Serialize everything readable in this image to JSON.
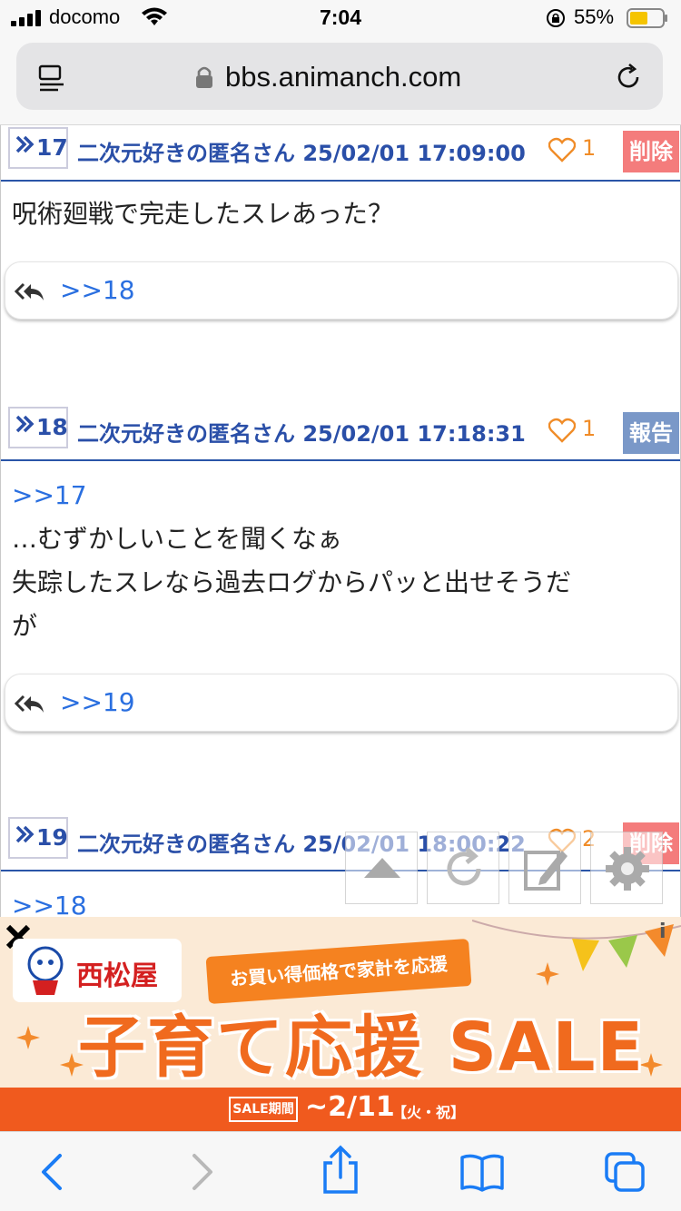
{
  "status_bar": {
    "carrier": "docomo",
    "time": "7:04",
    "battery": "55%"
  },
  "browser": {
    "url": "bbs.animanch.com"
  },
  "posts": [
    {
      "num": "17",
      "meta": "二次元好きの匿名さん 25/02/01 17:09:00",
      "likes": "1",
      "action": "削除",
      "body_lines": [
        "呪術廻戦で完走したスレあった？"
      ],
      "reply": ">>18"
    },
    {
      "num": "18",
      "meta": "二次元好きの匿名さん 25/02/01 17:18:31",
      "likes": "1",
      "action": "報告",
      "anchor": ">>17",
      "body_lines": [
        "…むずかしいことを聞くなぁ",
        "失踪したスレなら過去ログからパッと出せそうだ",
        "が"
      ],
      "reply": ">>19"
    },
    {
      "num": "19",
      "meta": "二次元好きの匿名さん 25/02/01 18:00:22",
      "likes": "2",
      "action": "削除",
      "anchor": ">>18"
    }
  ],
  "ad": {
    "brand": "西松屋",
    "ribbon": "お買い得価格で家計を応援",
    "headline": "子育て応援 SALE",
    "period_label": "SALE期間",
    "date": "~2/11",
    "dow": "【火・祝】",
    "info": "i"
  },
  "icons": {
    "reader": "reader-mode-icon",
    "lock": "lock-icon",
    "reload": "reload-icon",
    "back": "back-arrow-icon",
    "forward": "forward-arrow-icon",
    "share": "share-icon",
    "bookmarks": "book-icon",
    "tabs": "tabs-icon"
  },
  "colors": {
    "link_blue": "#2a6fe0",
    "meta_blue": "#2a4fa8",
    "like_orange": "#f08c28",
    "delete_red": "#f47c7c",
    "report_blue": "#7a98c8",
    "ad_orange": "#f06a1e"
  }
}
